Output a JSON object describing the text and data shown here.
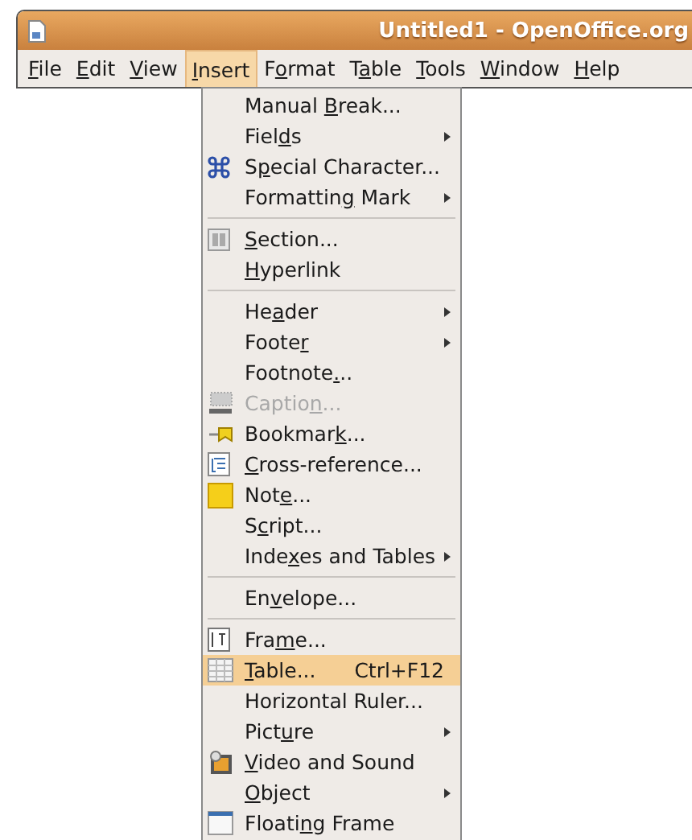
{
  "window": {
    "title": "Untitled1 - OpenOffice.org"
  },
  "menubar": [
    {
      "label": {
        "key": "F",
        "after": "ile"
      },
      "selected": false
    },
    {
      "label": {
        "key": "E",
        "after": "dit"
      },
      "selected": false
    },
    {
      "label": {
        "key": "V",
        "after": "iew"
      },
      "selected": false
    },
    {
      "label": {
        "key": "I",
        "after": "nsert"
      },
      "selected": true
    },
    {
      "label": {
        "before": "F",
        "key": "o",
        "after": "rmat"
      },
      "selected": false
    },
    {
      "label": {
        "before": "T",
        "key": "a",
        "after": "ble"
      },
      "selected": false
    },
    {
      "label": {
        "key": "T",
        "after": "ools"
      },
      "selected": false
    },
    {
      "label": {
        "key": "W",
        "after": "indow"
      },
      "selected": false
    },
    {
      "label": {
        "key": "H",
        "after": "elp"
      },
      "selected": false
    }
  ],
  "menu": [
    {
      "kind": "plain",
      "label": {
        "before": "Manual ",
        "key": "B",
        "after": "reak..."
      },
      "submenu": false,
      "disabled": false,
      "selected": false
    },
    {
      "kind": "plain",
      "label": {
        "before": "Fiel",
        "key": "d",
        "after": "s"
      },
      "submenu": true,
      "disabled": false,
      "selected": false
    },
    {
      "kind": "command",
      "label": {
        "before": "S",
        "key": "p",
        "after": "ecial Character..."
      },
      "submenu": false,
      "disabled": false,
      "selected": false
    },
    {
      "kind": "plain",
      "label": {
        "before": "Formattin",
        "key": "g",
        "after": " Mark"
      },
      "submenu": true,
      "disabled": false,
      "selected": false
    },
    {
      "kind": "separator"
    },
    {
      "kind": "section",
      "label": {
        "key": "S",
        "after": "ection..."
      },
      "submenu": false,
      "disabled": false,
      "selected": false
    },
    {
      "kind": "plain",
      "label": {
        "key": "H",
        "after": "yperlink"
      },
      "submenu": false,
      "disabled": false,
      "selected": false
    },
    {
      "kind": "separator"
    },
    {
      "kind": "plain",
      "label": {
        "before": "He",
        "key": "a",
        "after": "der"
      },
      "submenu": true,
      "disabled": false,
      "selected": false
    },
    {
      "kind": "plain",
      "label": {
        "before": "Foote",
        "key": "r"
      },
      "submenu": true,
      "disabled": false,
      "selected": false
    },
    {
      "kind": "plain",
      "label": {
        "before": "Footnote",
        "key": ".",
        "after": ".."
      },
      "submenu": false,
      "disabled": false,
      "selected": false
    },
    {
      "kind": "caption",
      "label": {
        "before": "Captio",
        "key": "n",
        "after": "..."
      },
      "submenu": false,
      "disabled": true,
      "selected": false
    },
    {
      "kind": "bookmark",
      "label": {
        "before": "Bookmar",
        "key": "k",
        "after": "..."
      },
      "submenu": false,
      "disabled": false,
      "selected": false
    },
    {
      "kind": "crossref",
      "label": {
        "key": "C",
        "after": "ross-reference..."
      },
      "submenu": false,
      "disabled": false,
      "selected": false
    },
    {
      "kind": "note",
      "label": {
        "before": "Not",
        "key": "e",
        "after": "..."
      },
      "submenu": false,
      "disabled": false,
      "selected": false
    },
    {
      "kind": "plain",
      "label": {
        "before": "S",
        "key": "c",
        "after": "ript..."
      },
      "submenu": false,
      "disabled": false,
      "selected": false
    },
    {
      "kind": "plain",
      "label": {
        "before": "Inde",
        "key": "x",
        "after": "es and Tables"
      },
      "submenu": true,
      "disabled": false,
      "selected": false
    },
    {
      "kind": "separator"
    },
    {
      "kind": "plain",
      "label": {
        "before": "En",
        "key": "v",
        "after": "elope..."
      },
      "submenu": false,
      "disabled": false,
      "selected": false
    },
    {
      "kind": "separator"
    },
    {
      "kind": "frame",
      "label": {
        "before": "Fra",
        "key": "m",
        "after": "e..."
      },
      "submenu": false,
      "disabled": false,
      "selected": false
    },
    {
      "kind": "table",
      "label": {
        "key": "T",
        "after": "able..."
      },
      "shortcut": "Ctrl+F12",
      "submenu": false,
      "disabled": false,
      "selected": true
    },
    {
      "kind": "plain",
      "label": {
        "before": "Horizontal Ruler..."
      },
      "submenu": false,
      "disabled": false,
      "selected": false
    },
    {
      "kind": "plain",
      "label": {
        "before": "Pict",
        "key": "u",
        "after": "re"
      },
      "submenu": true,
      "disabled": false,
      "selected": false
    },
    {
      "kind": "video",
      "label": {
        "key": "V",
        "after": "ideo and Sound"
      },
      "submenu": false,
      "disabled": false,
      "selected": false
    },
    {
      "kind": "plain",
      "label": {
        "key": "O",
        "after": "bject"
      },
      "submenu": true,
      "disabled": false,
      "selected": false
    },
    {
      "kind": "floating",
      "label": {
        "before": "Floati",
        "key": "n",
        "after": "g Frame"
      },
      "submenu": false,
      "disabled": false,
      "selected": false
    }
  ]
}
